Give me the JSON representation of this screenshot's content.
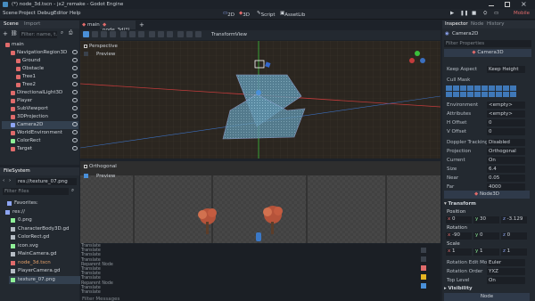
{
  "window": {
    "title": "(*) node_3d.tscn - jx2_remake - Godot Engine"
  },
  "menu": {
    "items": [
      "Scene",
      "Project",
      "Debug",
      "Editor",
      "Help"
    ]
  },
  "workspaces": {
    "w2d": "2D",
    "w3d": "3D",
    "script": "Script",
    "assetlib": "AssetLib"
  },
  "renderer": "Mobile",
  "scene_dock": {
    "tabs": [
      "Scene",
      "Import"
    ],
    "filter_placeholder": "Filter: name, t...",
    "tree": [
      {
        "label": "main",
        "color": "#e06b6b",
        "indent": 0
      },
      {
        "label": "NavigationRegion3D",
        "color": "#e06b6b",
        "indent": 1
      },
      {
        "label": "Ground",
        "color": "#e06b6b",
        "indent": 2
      },
      {
        "label": "Obstacle",
        "color": "#e06b6b",
        "indent": 2
      },
      {
        "label": "Tree1",
        "color": "#e06b6b",
        "indent": 2
      },
      {
        "label": "Tree2",
        "color": "#e06b6b",
        "indent": 2
      },
      {
        "label": "DirectionalLight3D",
        "color": "#e06b6b",
        "indent": 1
      },
      {
        "label": "Player",
        "color": "#e06b6b",
        "indent": 1
      },
      {
        "label": "SubViewport",
        "color": "#e06b6b",
        "indent": 1
      },
      {
        "label": "3DProjection",
        "color": "#e06b6b",
        "indent": 1
      },
      {
        "label": "Camera2D",
        "color": "#8da5f3",
        "indent": 1
      },
      {
        "label": "WorldEnvironment",
        "color": "#e06b6b",
        "indent": 1
      },
      {
        "label": "ColorRect",
        "color": "#8eef97",
        "indent": 1
      },
      {
        "label": "Target",
        "color": "#e06b6b",
        "indent": 1
      }
    ]
  },
  "filesystem": {
    "title": "FileSystem",
    "path": "res://texture_07.png",
    "filter_placeholder": "Filter Files",
    "items": [
      {
        "label": "Favorites:",
        "kind": "folder"
      },
      {
        "label": "res://",
        "kind": "folder"
      },
      {
        "label": "0.png",
        "kind": "image"
      },
      {
        "label": "CharacterBody3D.gd",
        "kind": "script"
      },
      {
        "label": "ColorRect.gd",
        "kind": "script"
      },
      {
        "label": "icon.svg",
        "kind": "image"
      },
      {
        "label": "MainCamera.gd",
        "kind": "script"
      },
      {
        "label": "node_3d.tscn",
        "kind": "scene"
      },
      {
        "label": "PlayerCamera.gd",
        "kind": "script"
      },
      {
        "label": "texture_07.png",
        "kind": "image"
      }
    ]
  },
  "editor_tabs": [
    {
      "label": "main"
    },
    {
      "label": "node_3d(*)"
    }
  ],
  "viewport_toolbar": {
    "transform": "Transform",
    "view": "View"
  },
  "viewports": {
    "top": {
      "label": "Perspective",
      "preview": "Preview"
    },
    "bottom": {
      "label": "Orthogonal",
      "preview": "Preview"
    }
  },
  "output_lines": [
    "Translate",
    "Translate",
    "Translate",
    "Translate",
    "Reparent Node",
    "Translate",
    "Translate",
    "Translate",
    "Reparent Node",
    "Translate",
    "Translate"
  ],
  "output_filter_placeholder": "Filter Messages",
  "inspector": {
    "tabs": [
      "Inspector",
      "Node",
      "History"
    ],
    "node_name": "Camera2D",
    "filter_placeholder": "Filter Properties",
    "class_name": "Camera3D",
    "rows": [
      {
        "key": "Keep Aspect",
        "value": "Keep Height"
      },
      {
        "key": "Cull Mask",
        "value": ""
      },
      {
        "key": "Environment",
        "value": "<empty>"
      },
      {
        "key": "Attributes",
        "value": "<empty>"
      },
      {
        "key": "H Offset",
        "value": "0"
      },
      {
        "key": "V Offset",
        "value": "0"
      },
      {
        "key": "Doppler Tracking",
        "value": "Disabled"
      },
      {
        "key": "Projection",
        "value": "Orthogonal"
      },
      {
        "key": "Current",
        "value": "On"
      },
      {
        "key": "Size",
        "value": "6.4"
      },
      {
        "key": "Near",
        "value": "0.05"
      },
      {
        "key": "Far",
        "value": "4000"
      }
    ],
    "node3d_section": "Node3D",
    "transform_section": "Transform",
    "position_label": "Position",
    "position": {
      "x": "0",
      "y": "30",
      "z": "-3.129"
    },
    "rotation_label": "Rotation",
    "rotation": {
      "x": "-90",
      "y": "0",
      "z": "0"
    },
    "scale_label": "Scale",
    "scale": {
      "x": "1",
      "y": "1",
      "z": "1"
    },
    "rotation_edit_mode": {
      "key": "Rotation Edit Mode",
      "value": "Euler"
    },
    "rotation_order": {
      "key": "Rotation Order",
      "value": "YXZ"
    },
    "top_level": {
      "key": "Top Level",
      "value": "On"
    },
    "visibility_section": "Visibility",
    "node_section": "Node"
  },
  "colors": {
    "accent": "#4a90d9",
    "bg": "#1d2229",
    "panel": "#232930"
  }
}
